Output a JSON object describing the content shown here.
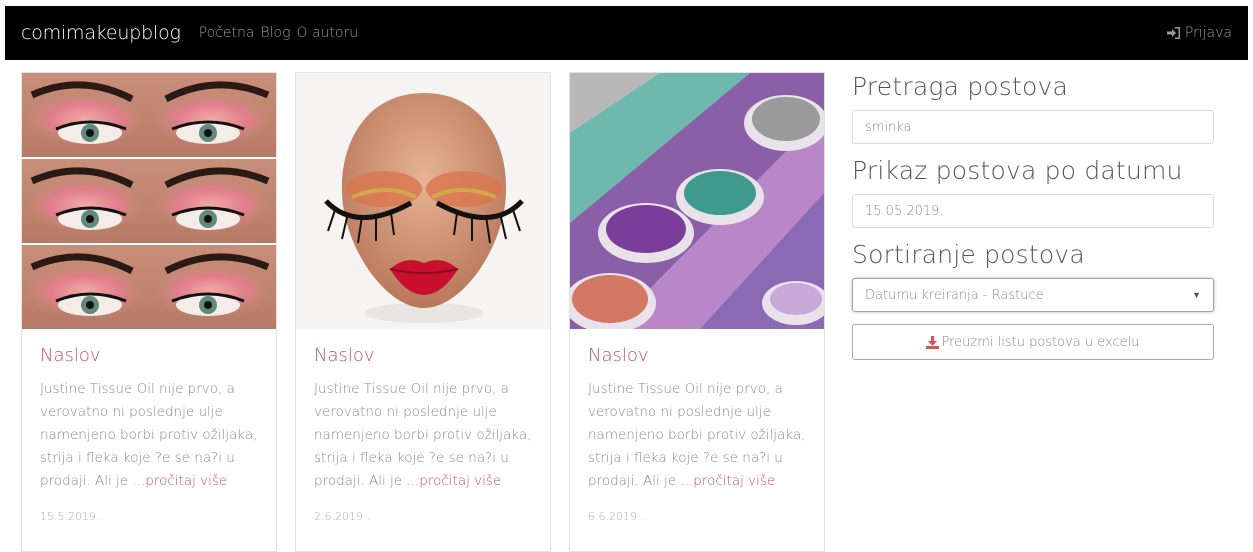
{
  "nav": {
    "brand": "comimakeupblog",
    "links": [
      "Početna",
      "Blog",
      "O autoru"
    ],
    "login": "Prijava"
  },
  "posts": [
    {
      "title": "Naslov",
      "excerpt": "Justine Tissue Oil nije prvo, a verovatno ni poslednje ulje namenjeno borbi protiv ožiljaka, strija i fleka koje ?e se na?i u prodaji. Ali je ...",
      "read_more": "pročitaj više",
      "date": "15.5.2019 ."
    },
    {
      "title": "Naslov",
      "excerpt": "Justine Tissue Oil nije prvo, a verovatno ni poslednje ulje namenjeno borbi protiv ožiljaka, strija i fleka koje ?e se na?i u prodaji. Ali je ...",
      "read_more": "pročitaj više",
      "date": "2.6.2019 ."
    },
    {
      "title": "Naslov",
      "excerpt": "Justine Tissue Oil nije prvo, a verovatno ni poslednje ulje namenjeno borbi protiv ožiljaka, strija i fleka koje ?e se na?i u prodaji. Ali je ...",
      "read_more": "pročitaj više",
      "date": "6.6.2019 ."
    }
  ],
  "sidebar": {
    "search_heading": "Pretraga postova",
    "search_value": "sminka",
    "date_heading": "Prikaz postova po datumu",
    "date_value": "15.05.2019.",
    "sort_heading": "Sortiranje postova",
    "sort_selected": "Datumu kreiranja - Rastuce",
    "export_label": "Preuzmi listu postova u excelu"
  },
  "colors": {
    "accent": "#c0535f",
    "navbar": "#000000",
    "download_icon": "#d9534f"
  }
}
